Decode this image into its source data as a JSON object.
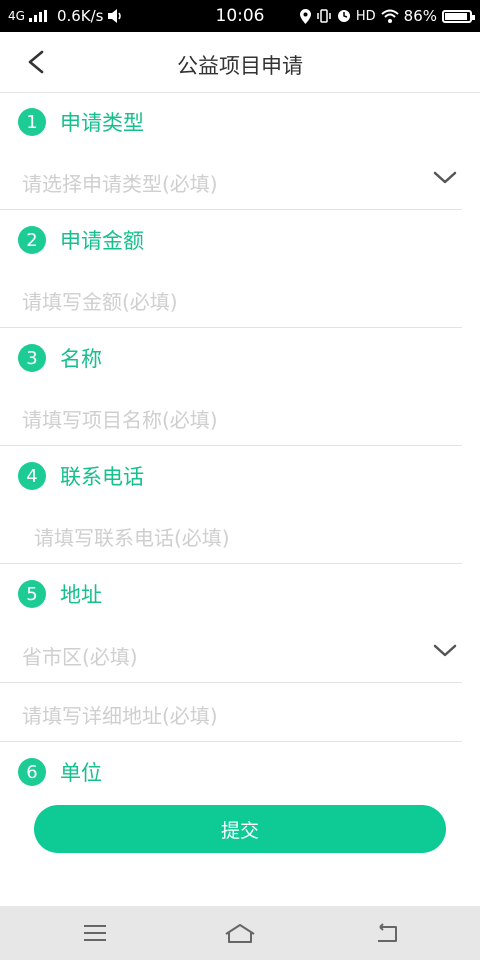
{
  "status_bar": {
    "network": "4G",
    "speed": "0.6K/s",
    "time": "10:06",
    "hd": "HD",
    "battery": "86%",
    "battery_level": 0.86
  },
  "header": {
    "title": "公益项目申请",
    "back_icon": "chevron-left-icon"
  },
  "sections": [
    {
      "number": "1",
      "label": "申请类型",
      "fields": [
        {
          "placeholder": "请选择申请类型(必填)",
          "dropdown": true
        }
      ]
    },
    {
      "number": "2",
      "label": "申请金额",
      "fields": [
        {
          "placeholder": "请填写金额(必填)",
          "dropdown": false
        }
      ]
    },
    {
      "number": "3",
      "label": "名称",
      "fields": [
        {
          "placeholder": "请填写项目名称(必填)",
          "dropdown": false
        }
      ]
    },
    {
      "number": "4",
      "label": "联系电话",
      "fields": [
        {
          "placeholder": "请填写联系电话(必填)",
          "dropdown": false
        }
      ]
    },
    {
      "number": "5",
      "label": "地址",
      "fields": [
        {
          "placeholder": "省市区(必填)",
          "dropdown": true
        },
        {
          "placeholder": "请填写详细地址(必填)",
          "dropdown": false
        }
      ]
    },
    {
      "number": "6",
      "label": "单位",
      "fields": []
    }
  ],
  "submit_label": "提交",
  "colors": {
    "accent": "#16c08d",
    "badge": "#1ccc94",
    "button": "#0ecb96",
    "placeholder": "#cfcfcf"
  },
  "nav_bar": {
    "menu_icon": "menu-icon",
    "home_icon": "home-icon",
    "back_icon": "back-icon"
  }
}
